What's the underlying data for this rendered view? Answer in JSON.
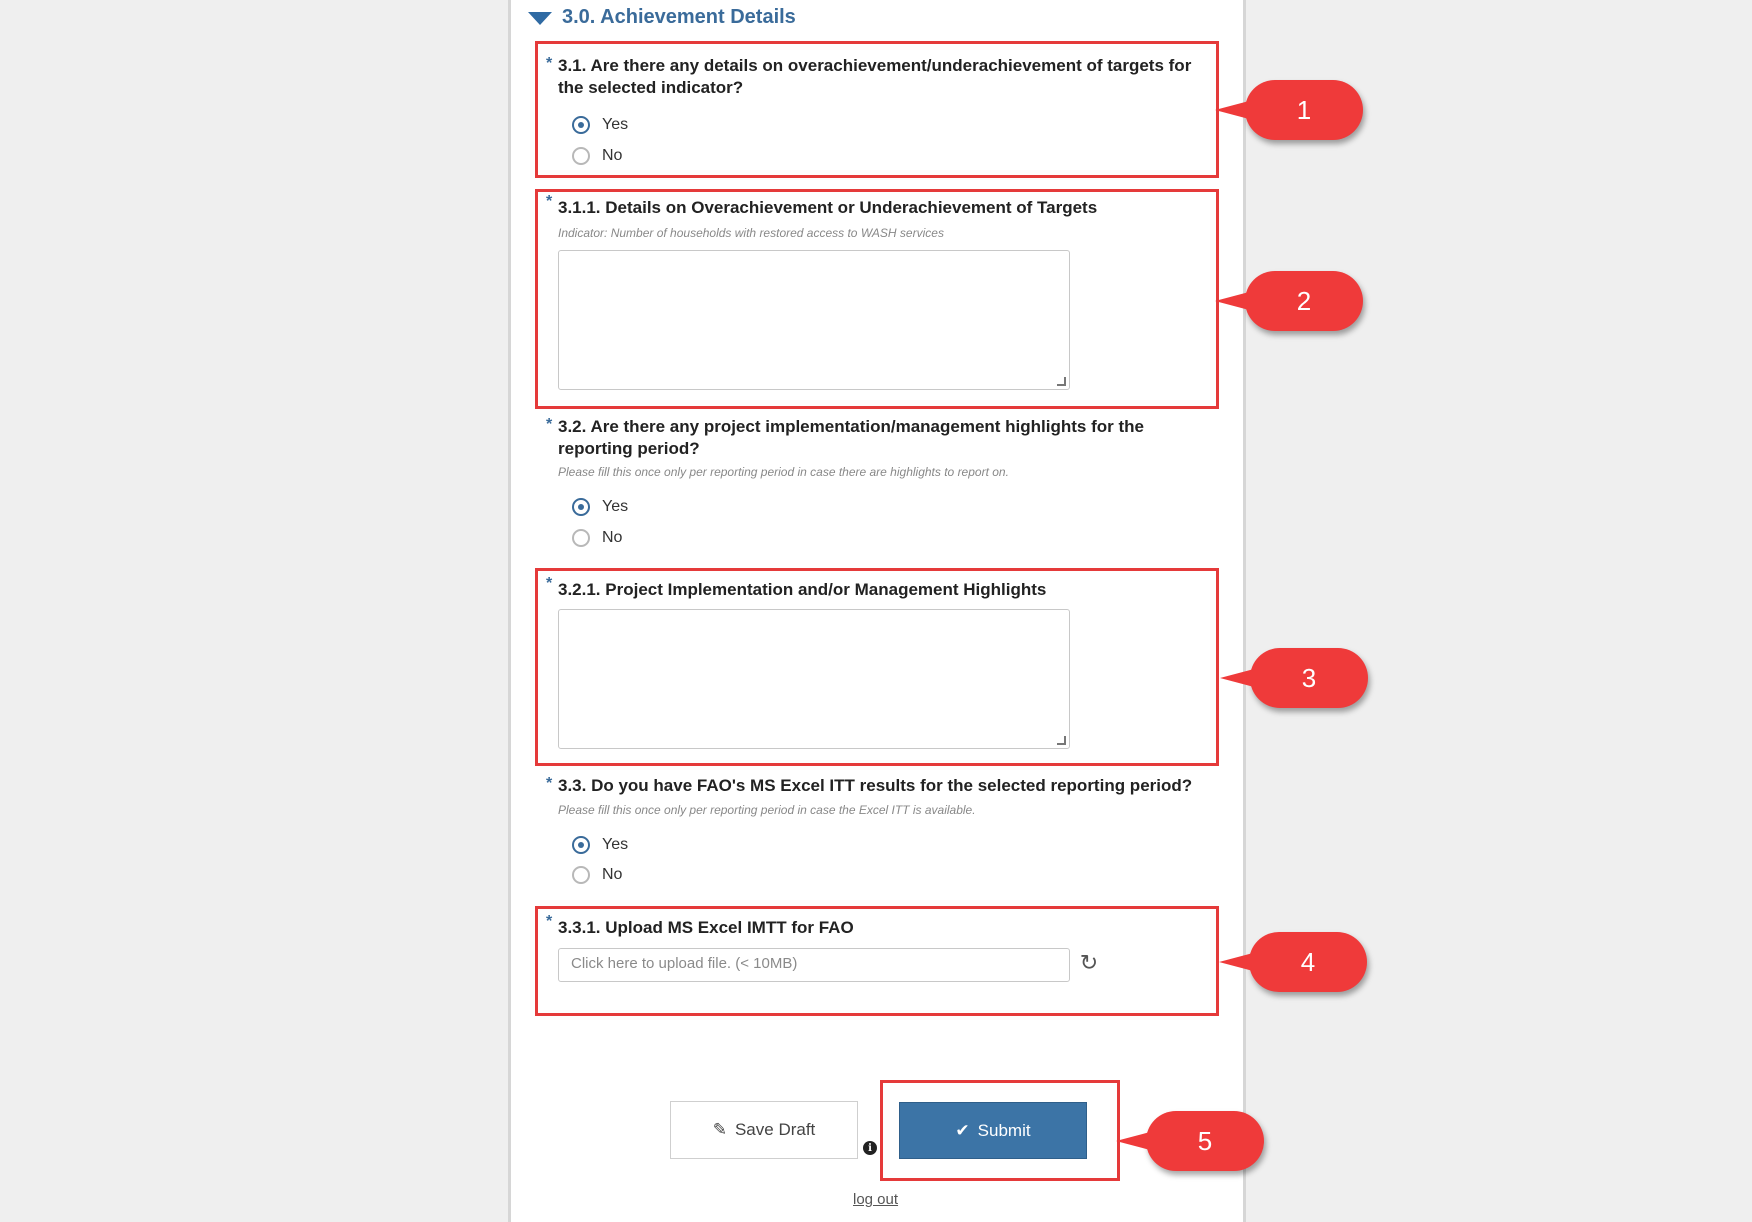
{
  "section": {
    "title": "3.0. Achievement Details"
  },
  "questions": {
    "q31": {
      "label": "3.1. Are there any details on overachievement/underachievement of targets for the selected indicator?",
      "yes": "Yes",
      "no": "No",
      "selected": "Yes"
    },
    "q311": {
      "label": "3.1.1. Details on Overachievement or Underachievement of Targets",
      "hint": "Indicator: Number of households with restored access to WASH services",
      "value": ""
    },
    "q32": {
      "label": "3.2. Are there any project implementation/management highlights for the reporting period?",
      "hint": "Please fill this once only per reporting period in case there are highlights to report on.",
      "yes": "Yes",
      "no": "No",
      "selected": "Yes"
    },
    "q321": {
      "label": "3.2.1. Project Implementation and/or Management Highlights",
      "value": ""
    },
    "q33": {
      "label": "3.3. Do you have FAO's MS Excel ITT results for the selected reporting period?",
      "hint": "Please fill this once only per reporting period in case the Excel ITT is available.",
      "yes": "Yes",
      "no": "No",
      "selected": "Yes"
    },
    "q331": {
      "label": "3.3.1. Upload MS Excel IMTT for FAO",
      "placeholder": "Click here to upload file. (< 10MB)"
    }
  },
  "required_marker": "*",
  "buttons": {
    "save_draft": "Save Draft",
    "submit": "Submit",
    "logout": "log out"
  },
  "callouts": [
    "1",
    "2",
    "3",
    "4",
    "5"
  ],
  "colors": {
    "accent": "#3a6b9a",
    "callout": "#ef3a3a",
    "submit": "#3c74a6"
  }
}
